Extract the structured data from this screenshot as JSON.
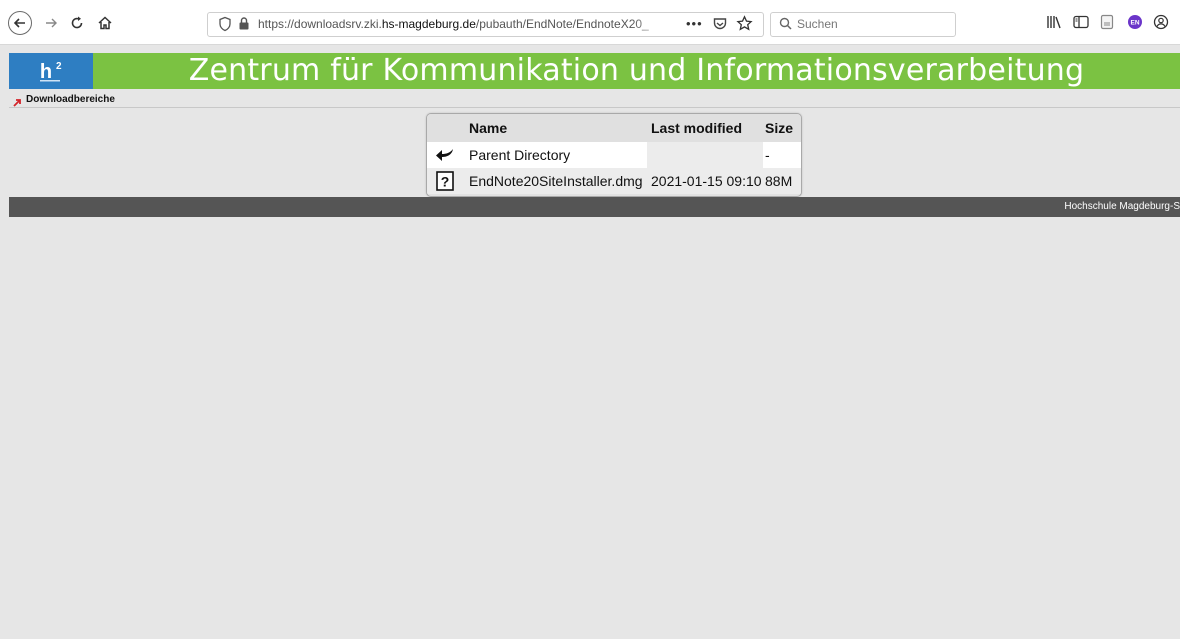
{
  "browser": {
    "url_prefix": "https://downloadsrv.zki.",
    "url_host": "hs-magdeburg.de",
    "url_path": "/pubauth/EndNote/EndnoteX20_",
    "more_label": "•••",
    "search_placeholder": "Suchen",
    "extension_label": "EN"
  },
  "header": {
    "title": "Zentrum für Kommunikation und Informationsverarbeitung",
    "logo_text": "h²"
  },
  "breadcrumb": {
    "label": "Downloadbereiche"
  },
  "listing": {
    "columns": [
      "Name",
      "Last modified",
      "Size"
    ],
    "rows": [
      {
        "icon": "back-arrow-icon",
        "name": "Parent Directory",
        "modified": "",
        "size": "-"
      },
      {
        "icon": "unknown-file-icon",
        "name": "EndNote20SiteInstaller.dmg",
        "modified": "2021-01-15 09:10",
        "size": "88M"
      }
    ]
  },
  "footer": {
    "text": "Hochschule Magdeburg-S"
  },
  "colors": {
    "header_green": "#7bc242",
    "logo_blue": "#2e7ec2",
    "footer_gray": "#555555",
    "page_bg": "#e6e6e6"
  }
}
